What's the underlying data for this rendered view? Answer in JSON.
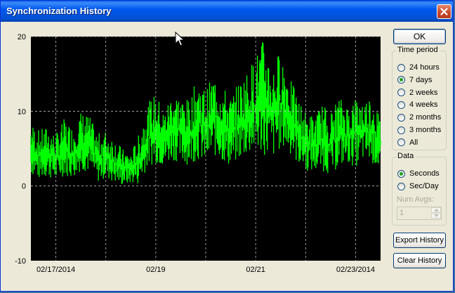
{
  "window": {
    "title": "Synchronization History"
  },
  "buttons": {
    "ok": "OK",
    "export": "Export History",
    "clear": "Clear History"
  },
  "time_period": {
    "legend": "Time period",
    "options": [
      {
        "label": "24 hours",
        "selected": false
      },
      {
        "label": "7 days",
        "selected": true
      },
      {
        "label": "2 weeks",
        "selected": false
      },
      {
        "label": "4 weeks",
        "selected": false
      },
      {
        "label": "2 months",
        "selected": false
      },
      {
        "label": "3 months",
        "selected": false
      },
      {
        "label": "All",
        "selected": false
      }
    ]
  },
  "data_group": {
    "legend": "Data",
    "options": [
      {
        "label": "Seconds",
        "selected": true
      },
      {
        "label": "Sec/Day",
        "selected": false
      }
    ],
    "num_avgs_label": "Num Avgs:",
    "num_avgs_value": "1"
  },
  "chart_data": {
    "type": "area",
    "title": "",
    "xlabel": "",
    "ylabel": "",
    "ylim": [
      -10,
      20
    ],
    "yticks": [
      -10,
      0,
      10,
      20
    ],
    "xticks": [
      "02/17/2014",
      "02/19",
      "02/21",
      "02/23/2014"
    ],
    "grid": true,
    "colors": {
      "background": "#000000",
      "series": "#00ff00",
      "grid": "#bdbdbd"
    },
    "series": [
      {
        "x_start": "02/16/2014 12:00",
        "x_end": "02/23/2014 12:00",
        "values_low": [
          1.5,
          0.8,
          1.2,
          0.6,
          1.4,
          1.0,
          2.0,
          1.8,
          0.5,
          1.0,
          0.4,
          0.0,
          0.3,
          0.2,
          2.5,
          3.0,
          2.5,
          3.5,
          3.0,
          2.8,
          3.5,
          3.0,
          4.0,
          3.2,
          2.5,
          3.5,
          4.0,
          4.5,
          4.0,
          3.5,
          5.0,
          4.5,
          3.0,
          2.0,
          1.8,
          2.0,
          1.5,
          2.5,
          3.0,
          2.5,
          3.5,
          3.0,
          2.0
        ],
        "values_high": [
          8.5,
          7.5,
          8.0,
          7.0,
          9.0,
          8.0,
          10.0,
          9.5,
          7.0,
          7.5,
          6.5,
          5.0,
          4.5,
          7.0,
          11.0,
          12.5,
          10.0,
          13.0,
          12.0,
          11.5,
          14.5,
          13.0,
          15.0,
          13.5,
          12.0,
          14.0,
          15.5,
          17.5,
          20.0,
          16.0,
          18.5,
          15.0,
          12.0,
          10.0,
          9.5,
          11.0,
          10.0,
          12.0,
          11.0,
          12.0,
          11.5,
          12.5,
          9.0
        ]
      }
    ]
  }
}
